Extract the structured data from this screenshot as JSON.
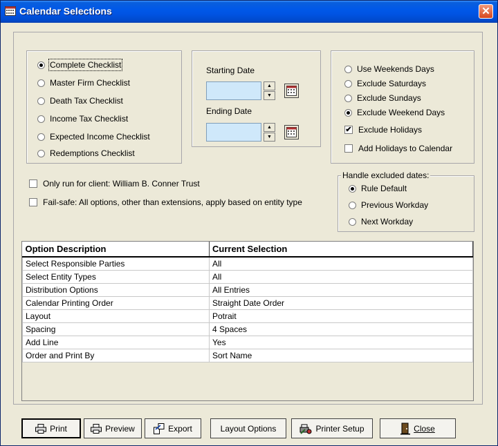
{
  "window": {
    "title": "Calendar Selections",
    "close_glyph": "✕",
    "title_icon": "calendar-icon"
  },
  "checklists": {
    "items": [
      {
        "label": "Complete Checklist",
        "selected": true
      },
      {
        "label": "Master Firm Checklist",
        "selected": false
      },
      {
        "label": "Death Tax Checklist",
        "selected": false
      },
      {
        "label": "Income Tax Checklist",
        "selected": false
      },
      {
        "label": "Expected Income Checklist",
        "selected": false
      },
      {
        "label": "Redemptions Checklist",
        "selected": false
      }
    ]
  },
  "dates": {
    "starting_label": "Starting Date",
    "starting_value": "",
    "ending_label": "Ending Date",
    "ending_value": ""
  },
  "weekend_options": {
    "items": [
      {
        "label": "Use Weekends Days",
        "selected": false
      },
      {
        "label": "Exclude Saturdays",
        "selected": false
      },
      {
        "label": "Exclude Sundays",
        "selected": false
      },
      {
        "label": "Exclude Weekend Days",
        "selected": true
      }
    ],
    "exclude_holidays": {
      "label": "Exclude Holidays",
      "checked": true,
      "check_glyph": "✔"
    },
    "add_holidays": {
      "label": "Add Holidays to Calendar",
      "checked": false
    }
  },
  "client_options": {
    "only_run": {
      "label": "Only run for client: William B. Conner Trust",
      "checked": false
    },
    "fail_safe": {
      "label": "Fail-safe:  All options, other than extensions, apply based on entity type",
      "checked": false
    }
  },
  "excluded_dates": {
    "title": "Handle excluded dates:",
    "items": [
      {
        "label": "Rule Default",
        "selected": true
      },
      {
        "label": "Previous Workday",
        "selected": false
      },
      {
        "label": "Next Workday",
        "selected": false
      }
    ]
  },
  "options_table": {
    "headers": [
      "Option Description",
      "Current Selection"
    ],
    "rows": [
      [
        "Select Responsible Parties",
        "All"
      ],
      [
        "Select Entity Types",
        "All"
      ],
      [
        "Distribution Options",
        "All Entries"
      ],
      [
        "Calendar Printing Order",
        "Straight Date Order"
      ],
      [
        "Layout",
        "Potrait"
      ],
      [
        "Spacing",
        "4 Spaces"
      ],
      [
        "Add Line",
        "Yes"
      ],
      [
        "Order and Print By",
        "Sort Name"
      ]
    ]
  },
  "buttons": {
    "print": "Print",
    "preview": "Preview",
    "export": "Export",
    "layout_options": "Layout Options",
    "printer_setup": "Printer Setup",
    "close": "Close"
  },
  "icons": {
    "print": "printer-icon",
    "preview": "printer-icon",
    "export": "export-icon",
    "printer_setup": "printer-setup-icon",
    "close": "door-exit-icon",
    "spin_up": "▲",
    "spin_down": "▼"
  },
  "colors": {
    "titlebar": "#0054e3",
    "date_field": "#cfe8fa",
    "dialog_bg": "#ece9d8",
    "close_button": "#d6461e"
  }
}
